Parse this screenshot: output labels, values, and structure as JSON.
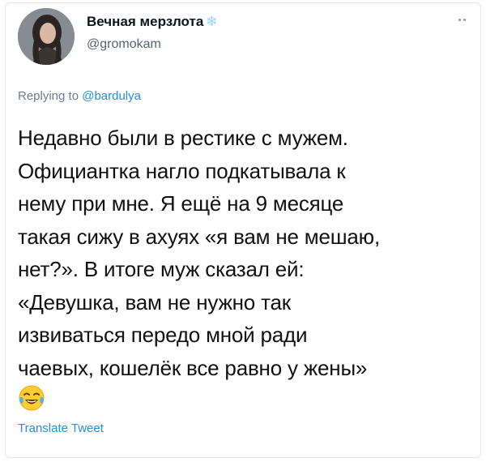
{
  "user": {
    "display_name": "Вечная мерзлота",
    "name_emoji_icon": "snowflake-icon",
    "handle": "@gromokam"
  },
  "reply": {
    "prefix": "Replying to ",
    "mention": "@bardulya"
  },
  "tweet": {
    "text": "Недавно были в рестике с мужем.\nОфициантка нагло подкатывала к\nнему при мне. Я ещё на 9 месяце\nтакая сижу в ахуях «я вам не мешаю,\nнет?». В итоге муж сказал ей:\n«Девушка, вам не нужно так\nизвиваться передо мной ради\nчаевых, кошелёк все равно у жены»",
    "emoji": "face-with-tears-of-joy-icon"
  },
  "actions": {
    "translate_label": "Translate Tweet"
  },
  "colors": {
    "link": "#2a8bd6",
    "secondary_text": "#536471",
    "snowflake": "#9ad3f2"
  }
}
